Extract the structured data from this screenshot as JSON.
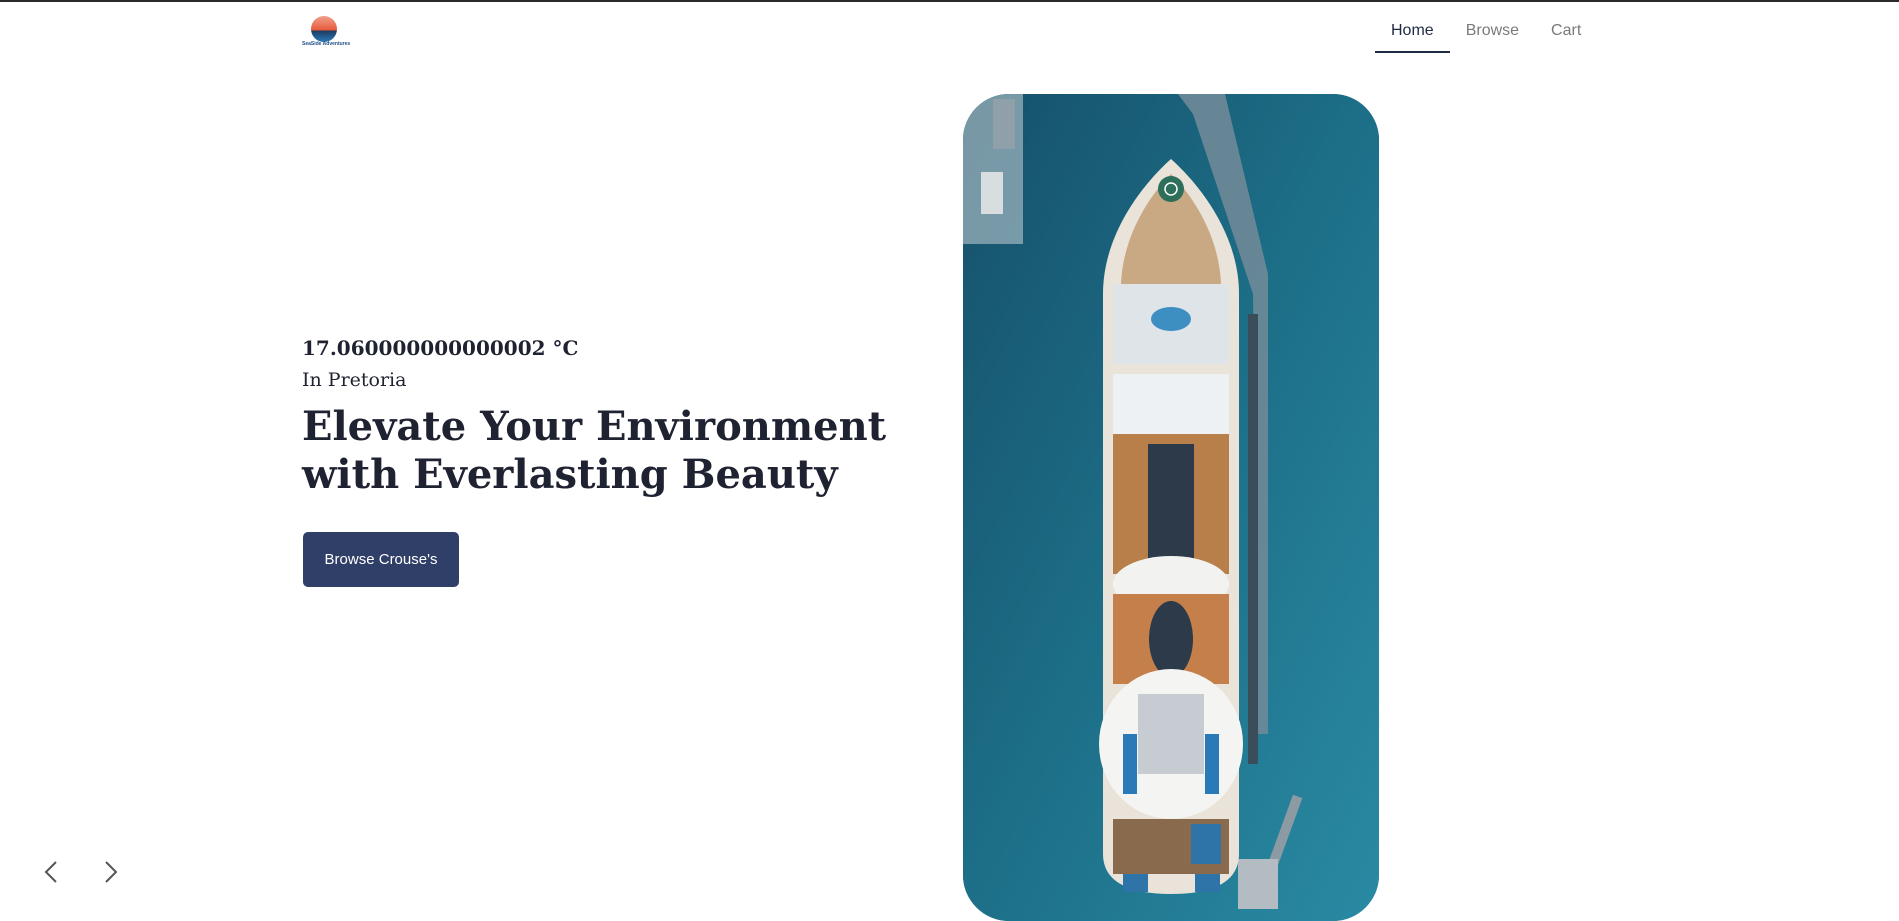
{
  "header": {
    "logo_text": "SeaSide Adventures",
    "nav": [
      {
        "label": "Home",
        "active": true
      },
      {
        "label": "Browse",
        "active": false
      },
      {
        "label": "Cart",
        "active": false
      }
    ]
  },
  "hero": {
    "temperature": "17.060000000000002 °C",
    "location": "In Pretoria",
    "headline": "Elevate Your Environment with Everlasting Beauty",
    "cta_label": "Browse Crouse's",
    "image_subject": "aerial view of cruise ship docked at pier"
  },
  "carousel": {
    "prev_icon": "chevron-left-icon",
    "next_icon": "chevron-right-icon"
  },
  "colors": {
    "accent": "#2f3f68",
    "text_dark": "#1f2230",
    "nav_inactive": "#7a7a7a",
    "sea": "#1f6f86"
  }
}
